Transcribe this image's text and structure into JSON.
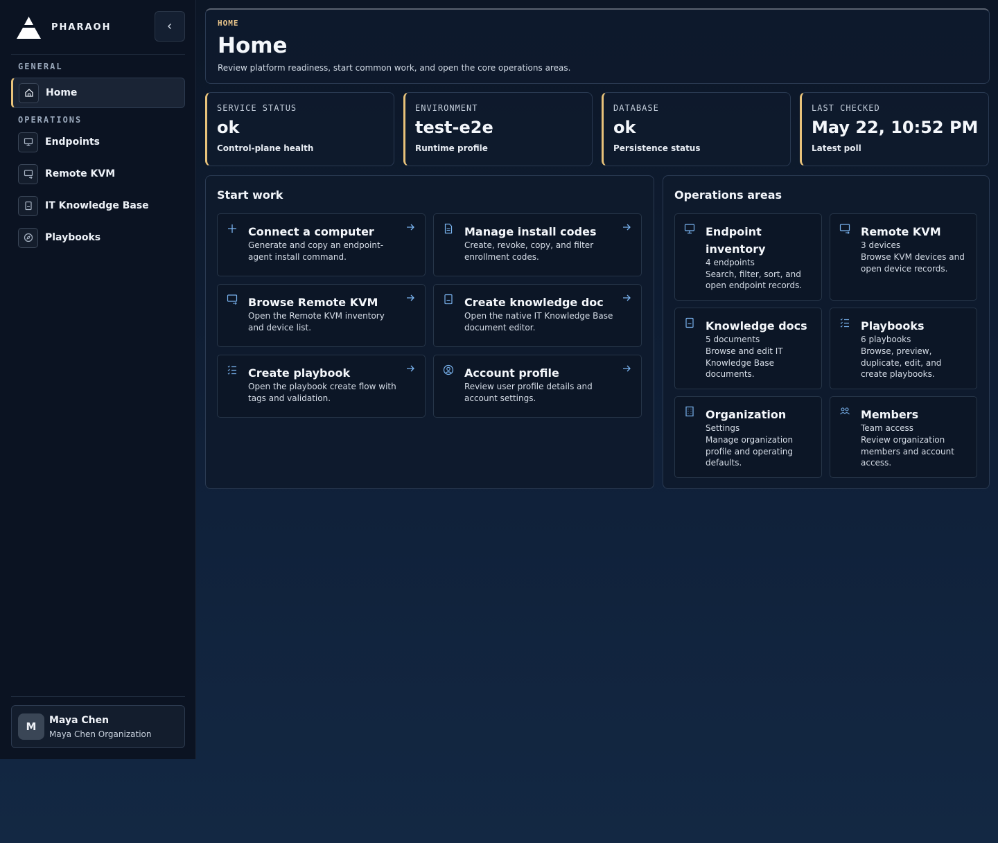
{
  "brand": {
    "name": "PHARAOH"
  },
  "sidebar": {
    "sections": {
      "general": "GENERAL",
      "operations": "OPERATIONS"
    },
    "items": [
      {
        "label": "Home",
        "icon": "home-icon"
      },
      {
        "label": "Endpoints",
        "icon": "monitor-icon"
      },
      {
        "label": "Remote KVM",
        "icon": "remote-screen-icon"
      },
      {
        "label": "IT Knowledge Base",
        "icon": "book-icon"
      },
      {
        "label": "Playbooks",
        "icon": "compass-icon"
      }
    ],
    "user": {
      "initial": "M",
      "name": "Maya Chen",
      "org": "Maya Chen Organization"
    }
  },
  "header": {
    "eyebrow": "HOME",
    "title": "Home",
    "description": "Review platform readiness, start common work, and open the core operations areas."
  },
  "stats": [
    {
      "label": "SERVICE STATUS",
      "value": "ok",
      "sub": "Control-plane health"
    },
    {
      "label": "ENVIRONMENT",
      "value": "test-e2e",
      "sub": "Runtime profile"
    },
    {
      "label": "DATABASE",
      "value": "ok",
      "sub": "Persistence status"
    },
    {
      "label": "LAST CHECKED",
      "value": "May 22, 10:52 PM",
      "sub": "Latest poll"
    }
  ],
  "start_work": {
    "title": "Start work",
    "cards": [
      {
        "title": "Connect a computer",
        "desc1": "Generate and copy an endpoint-",
        "desc2": "agent install command.",
        "icon": "plus-icon"
      },
      {
        "title": "Manage install codes",
        "desc1": "Create, revoke, copy, and filter",
        "desc2": "enrollment codes.",
        "icon": "document-icon"
      },
      {
        "title": "Browse Remote KVM",
        "desc1": "Open the Remote KVM inventory",
        "desc2": "and device list.",
        "icon": "remote-screen-icon"
      },
      {
        "title": "Create knowledge doc",
        "desc1": "Open the native IT Knowledge Base",
        "desc2": "document editor.",
        "icon": "book-icon"
      },
      {
        "title": "Create playbook",
        "desc1": "Open the playbook create flow with",
        "desc2": "tags and validation.",
        "icon": "checklist-icon"
      },
      {
        "title": "Account profile",
        "desc1": "Review user profile details and",
        "desc2": "account settings.",
        "icon": "user-circle-icon"
      }
    ]
  },
  "operations_areas": {
    "title": "Operations areas",
    "cards": [
      {
        "title": "Endpoint inventory",
        "lines": [
          "4 endpoints",
          "Search, filter, sort, and",
          "open endpoint records."
        ],
        "icon": "monitor-icon"
      },
      {
        "title": "Remote KVM",
        "lines": [
          "3 devices",
          "Browse KVM devices and",
          "open device records."
        ],
        "icon": "remote-screen-icon"
      },
      {
        "title": "Knowledge docs",
        "lines": [
          "5 documents",
          "Browse and edit IT",
          "Knowledge Base",
          "documents."
        ],
        "icon": "book-icon"
      },
      {
        "title": "Playbooks",
        "lines": [
          "6 playbooks",
          "Browse, preview,",
          "duplicate, edit, and",
          "create playbooks."
        ],
        "icon": "checklist-icon"
      },
      {
        "title": "Organization",
        "lines": [
          "Settings",
          "Manage organization",
          "profile and operating",
          "defaults."
        ],
        "icon": "building-icon"
      },
      {
        "title": "Members",
        "lines": [
          "Team access",
          "Review organization",
          "members and account",
          "access."
        ],
        "icon": "users-icon"
      }
    ]
  },
  "colors": {
    "accent": "#e8c27a",
    "link": "#7ab4f0"
  }
}
